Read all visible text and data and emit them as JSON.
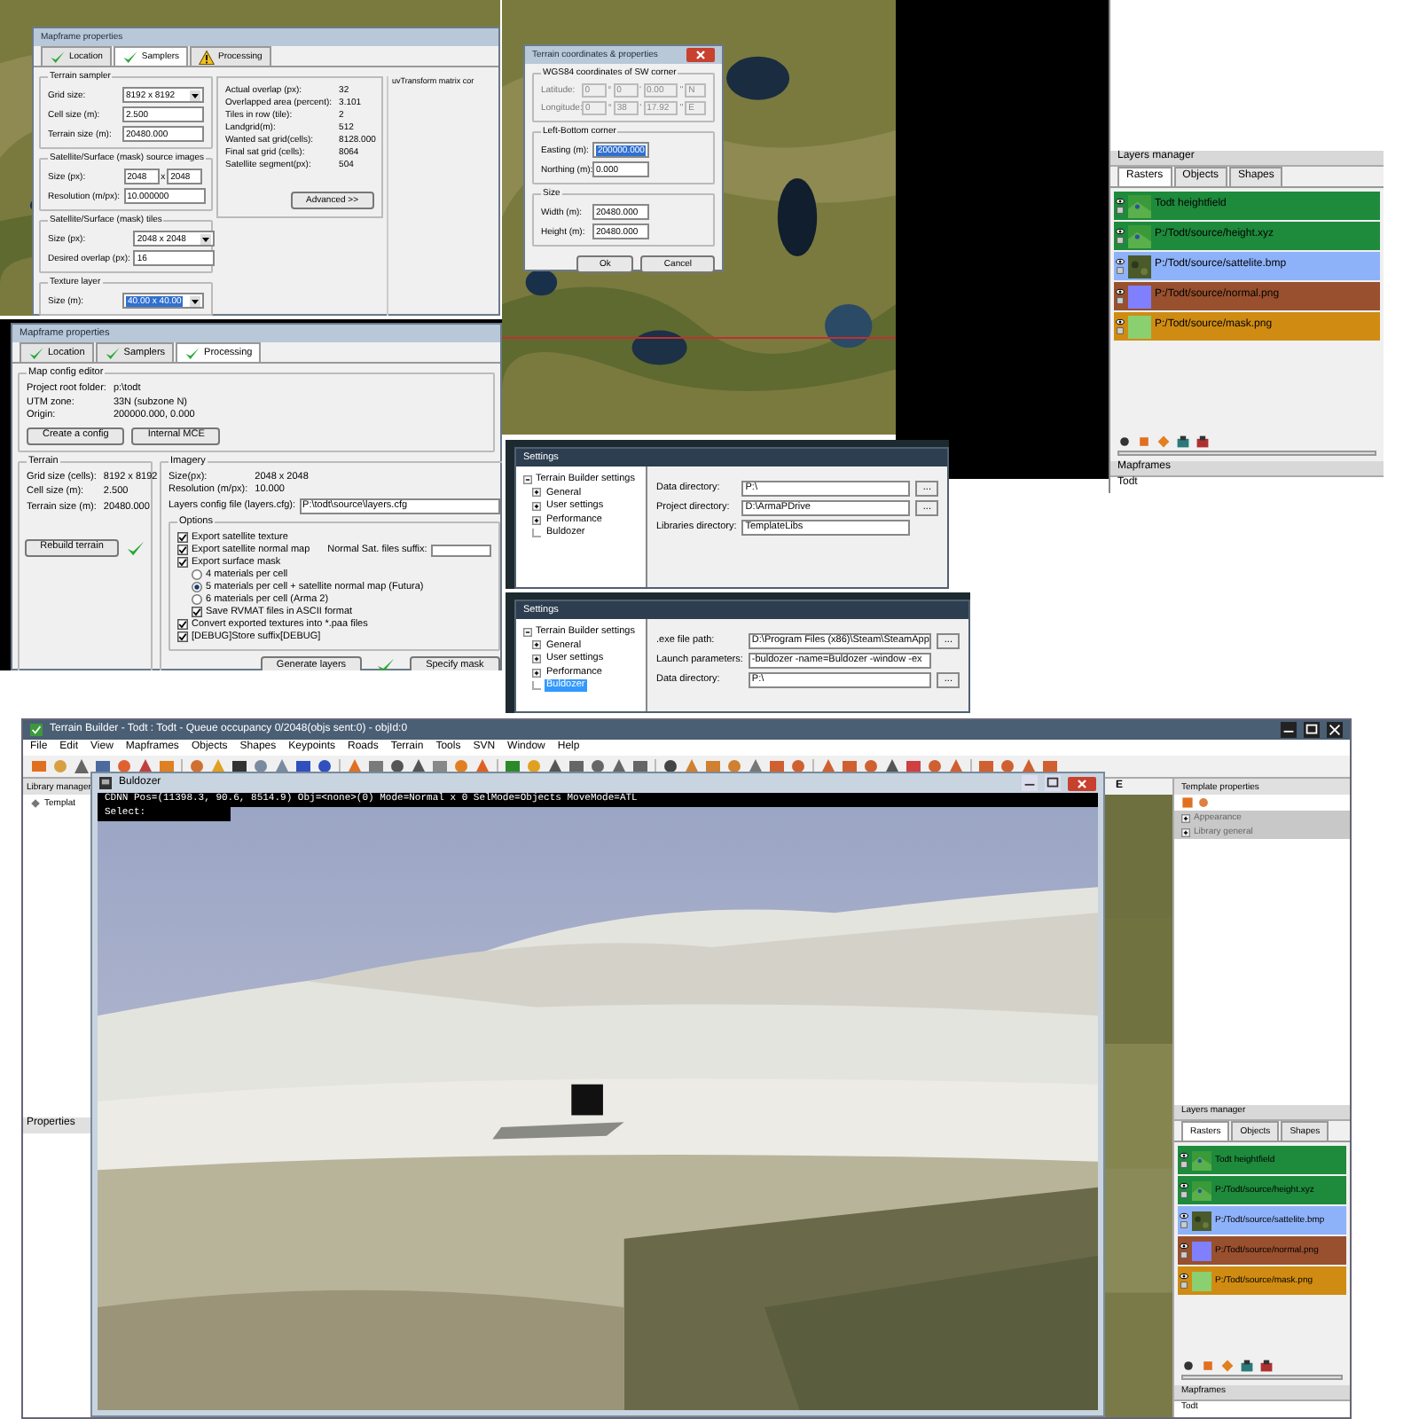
{
  "mapframe_samplers": {
    "title": "Mapframe properties",
    "tabs": [
      {
        "label": "Location",
        "selected": false,
        "kind": "ok"
      },
      {
        "label": "Samplers",
        "selected": true,
        "kind": "ok"
      },
      {
        "label": "Processing",
        "selected": false,
        "kind": "warning"
      }
    ],
    "groups": [
      {
        "title": "Terrain sampler",
        "fields": [
          {
            "label": "Grid size:",
            "kind": "dropdown",
            "value": "8192 x 8192"
          },
          {
            "label": "Cell size (m):",
            "kind": "input",
            "value": "2.500"
          },
          {
            "label": "Terrain size (m):",
            "kind": "input",
            "value": "20480.000"
          }
        ]
      },
      {
        "title": "Satellite/Surface (mask) source images",
        "fields": [
          {
            "label": "Size (px):",
            "kind": "pair",
            "value": "2048",
            "separator": "x",
            "value2": "2048"
          },
          {
            "label": "Resolution (m/px):",
            "kind": "input",
            "value": "10.000000"
          }
        ]
      },
      {
        "title": "Satellite/Surface (mask) tiles",
        "fields": [
          {
            "label": "Size (px):",
            "kind": "dropdown",
            "value": "2048 x 2048"
          },
          {
            "label": "Desired overlap (px):",
            "kind": "input",
            "value": "16"
          }
        ]
      },
      {
        "title": "Texture layer",
        "fields": [
          {
            "label": "Size (m):",
            "kind": "dropdown",
            "value": "40.00 x 40.00",
            "highlighted": true
          }
        ]
      }
    ],
    "stats": [
      {
        "label": "Actual overlap (px):",
        "value": "32"
      },
      {
        "label": "Overlapped area (percent):",
        "value": "3.101"
      },
      {
        "label": "Tiles in row (tile):",
        "value": "2"
      },
      {
        "label": "Landgrid(m):",
        "value": "512"
      },
      {
        "label": "Wanted sat grid(cells):",
        "value": "8128.000"
      },
      {
        "label": "Final sat grid (cells):",
        "value": "8064"
      },
      {
        "label": "Satellite segment(px):",
        "value": "504"
      }
    ],
    "advanced_button": "Advanced >>",
    "side_text": "uvTransform matrix cor"
  },
  "terrain_coords": {
    "title": "Terrain coordinates & properties",
    "wgs_group": {
      "title": "WGS84 coordinates of SW corner",
      "marks": [
        "°",
        "'",
        "\""
      ],
      "rows": [
        {
          "label": "Latitude:",
          "deg": "0",
          "min": "0",
          "sec": "0.00",
          "hemisphere": "N"
        },
        {
          "label": "Longitude:",
          "deg": "0",
          "min": "38",
          "sec": "17.92",
          "hemisphere": "E"
        }
      ]
    },
    "groups": [
      {
        "title": "Left-Bottom corner",
        "fields": [
          {
            "label": "Easting (m):",
            "value": "200000.000",
            "highlighted": true
          },
          {
            "label": "Northing (m):",
            "value": "0.000",
            "highlighted": false
          }
        ]
      },
      {
        "title": "Size",
        "fields": [
          {
            "label": "Width (m):",
            "value": "20480.000",
            "highlighted": false
          },
          {
            "label": "Height (m):",
            "value": "20480.000",
            "highlighted": false
          }
        ]
      }
    ],
    "buttons": [
      "Ok",
      "Cancel"
    ]
  },
  "layers_panel": {
    "title": "Layers manager",
    "tabs": [
      {
        "label": "Rasters",
        "selected": true
      },
      {
        "label": "Objects",
        "selected": false
      },
      {
        "label": "Shapes",
        "selected": false
      }
    ],
    "layers": [
      {
        "name": "Todt heightfield",
        "color": "#1e8a3c"
      },
      {
        "name": "P:/Todt/source/height.xyz",
        "color": "#1e8a3c"
      },
      {
        "name": "P:/Todt/source/sattelite.bmp",
        "color": "#8eb2fa"
      },
      {
        "name": "P:/Todt/source/normal.png",
        "color": "#98502e"
      },
      {
        "name": "P:/Todt/source/mask.png",
        "color": "#d08c12"
      }
    ],
    "footer_title": "Mapframes",
    "footer_item": "Todt"
  },
  "mapframe_processing": {
    "title": "Mapframe properties",
    "tabs": [
      {
        "label": "Location",
        "selected": false,
        "kind": "ok"
      },
      {
        "label": "Samplers",
        "selected": false,
        "kind": "ok"
      },
      {
        "label": "Processing",
        "selected": true,
        "kind": "ok"
      }
    ],
    "config_group": {
      "title": "Map config editor",
      "rows": [
        {
          "label": "Project root folder:",
          "value": "p:\\todt"
        },
        {
          "label": "UTM zone:",
          "value": "33N (subzone N)"
        },
        {
          "label": "Origin:",
          "value": "200000.000, 0.000"
        }
      ],
      "buttons": [
        "Create a config",
        "Internal MCE"
      ]
    },
    "terrain_group": {
      "title": "Terrain",
      "rows": [
        {
          "label": "Grid size (cells):",
          "value": "8192 x 8192"
        },
        {
          "label": "Cell size (m):",
          "value": "2.500"
        },
        {
          "label": "Terrain size (m):",
          "value": "20480.000"
        }
      ],
      "button": "Rebuild terrain",
      "done": true
    },
    "imagery_group": {
      "title": "Imagery",
      "rows": [
        {
          "label": "Size(px):",
          "value": "2048 x 2048"
        },
        {
          "label": "Resolution (m/px):",
          "value": "10.000"
        }
      ],
      "config_label": "Layers config file (layers.cfg):",
      "config_value": "P:\\todt\\source\\layers.cfg"
    },
    "options_group": {
      "title": "Options",
      "items": [
        {
          "kind": "checkbox",
          "label": "Export satellite texture",
          "checked": true
        },
        {
          "kind": "checkbox",
          "label": "Export satellite normal map",
          "checked": true,
          "suffix_label": "Normal Sat. files suffix:"
        },
        {
          "kind": "checkbox",
          "label": "Export surface mask",
          "checked": true
        },
        {
          "kind": "radio",
          "label": "4 materials per cell",
          "selected": false
        },
        {
          "kind": "radio",
          "label": "5 materials per cell + satellite normal map (Futura)",
          "selected": true
        },
        {
          "kind": "radio",
          "label": "6 materials per cell (Arma 2)",
          "selected": false
        },
        {
          "kind": "subcheckbox",
          "label": "Save RVMAT files in ASCII format",
          "checked": true
        },
        {
          "kind": "checkbox",
          "label": "Convert exported textures into *.paa files",
          "checked": true
        },
        {
          "kind": "checkbox",
          "label": "[DEBUG]Store suffix[DEBUG]",
          "checked": true
        }
      ]
    },
    "generate_button": "Generate layers",
    "generated": true,
    "mask_button": "Specify mask"
  },
  "settings_general": {
    "title": "Settings",
    "tree": {
      "label": "Terrain Builder settings",
      "children": [
        {
          "label": "General",
          "expandable": true,
          "selected": false
        },
        {
          "label": "User settings",
          "expandable": true,
          "selected": false
        },
        {
          "label": "Performance",
          "expandable": true,
          "selected": false
        },
        {
          "label": "Buldozer",
          "expandable": false,
          "selected": false
        }
      ]
    },
    "fields": [
      {
        "label": "Data directory:",
        "value": "P:\\",
        "browse": "..."
      },
      {
        "label": "Project directory:",
        "value": "D:\\ArmaPDrive",
        "browse": "..."
      },
      {
        "label": "Libraries directory:",
        "value": "TemplateLibs"
      }
    ]
  },
  "settings_buldozer": {
    "title": "Settings",
    "tree": {
      "label": "Terrain Builder settings",
      "children": [
        {
          "label": "General",
          "expandable": true,
          "selected": false
        },
        {
          "label": "User settings",
          "expandable": true,
          "selected": false
        },
        {
          "label": "Performance",
          "expandable": true,
          "selected": false
        },
        {
          "label": "Buldozer",
          "expandable": false,
          "selected": true
        }
      ]
    },
    "fields": [
      {
        "label": ".exe file path:",
        "value": "D:\\Program Files (x86)\\Steam\\SteamApp",
        "browse": "..."
      },
      {
        "label": "Launch parameters:",
        "value": "-buldozer -name=Buldozer -window -ex"
      },
      {
        "label": "Data directory:",
        "value": "P:\\",
        "browse": "..."
      }
    ]
  },
  "terrain_builder": {
    "title": "Terrain Builder - Todt : Todt - Queue occupancy 0/2048(objs sent:0) - objId:0",
    "menu": [
      "File",
      "Edit",
      "View",
      "Mapframes",
      "Objects",
      "Shapes",
      "Keypoints",
      "Roads",
      "Terrain",
      "Tools",
      "SVN",
      "Window",
      "Help"
    ],
    "library_panel": {
      "title": "Library manager",
      "item": "Templat"
    },
    "properties_title": "Properties",
    "buldozer": {
      "title": "Buldozer",
      "status_line": "CDNN Pos=(11398.3, 90.6, 8514.9) Obj=<none>(0) Mode=Normal x 0 SelMode=Objects MoveMode=ATL",
      "prompt": "Select:"
    },
    "map_column": "E",
    "template_panel": {
      "title": "Template properties",
      "sections": [
        "Appearance",
        "Library general"
      ]
    },
    "layers_panel": {
      "title": "Layers manager",
      "tabs": [
        {
          "label": "Rasters",
          "selected": true
        },
        {
          "label": "Objects",
          "selected": false
        },
        {
          "label": "Shapes",
          "selected": false
        }
      ],
      "layers": [
        {
          "name": "Todt heightfield",
          "color": "#1e8a3c"
        },
        {
          "name": "P:/Todt/source/height.xyz",
          "color": "#1e8a3c"
        },
        {
          "name": "P:/Todt/source/sattelite.bmp",
          "color": "#8eb2fa"
        },
        {
          "name": "P:/Todt/source/normal.png",
          "color": "#98502e"
        },
        {
          "name": "P:/Todt/source/mask.png",
          "color": "#d08c12"
        }
      ],
      "footer_title": "Mapframes",
      "footer_item": "Todt"
    }
  }
}
